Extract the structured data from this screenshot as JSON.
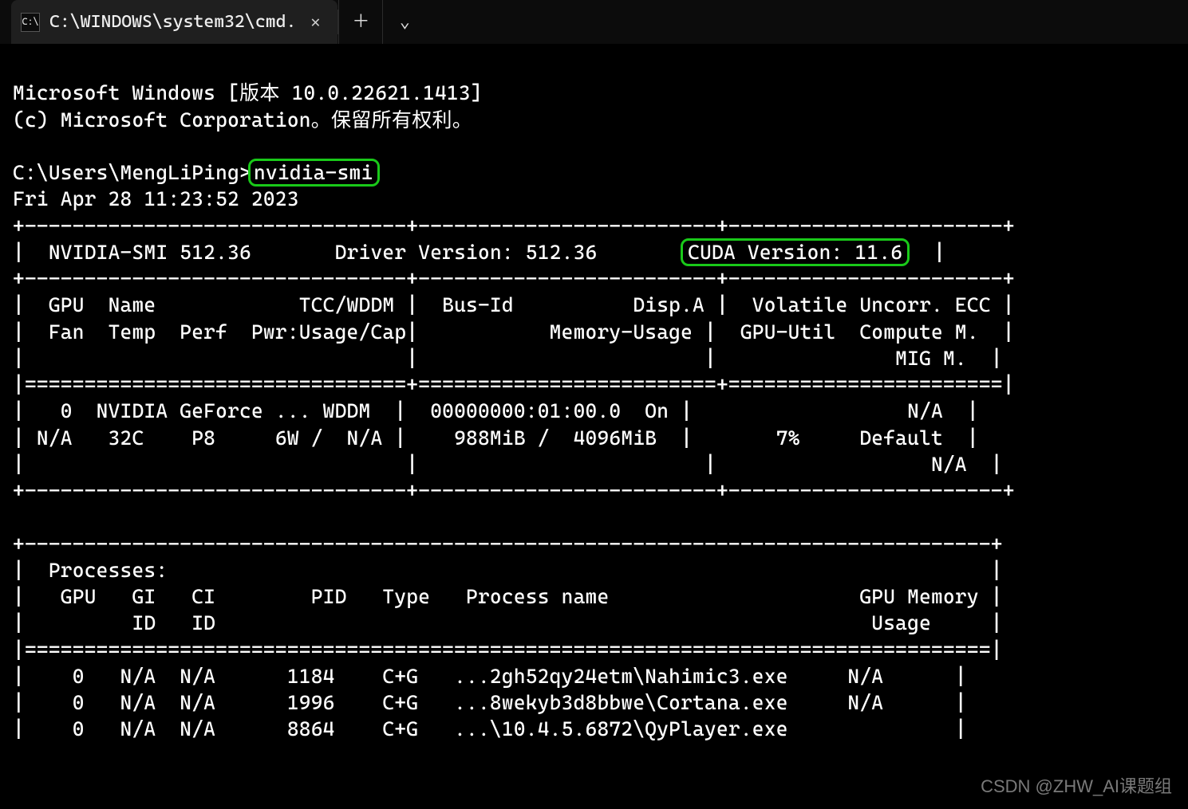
{
  "tab": {
    "icon_name": "cmd-icon",
    "title": "C:\\WINDOWS\\system32\\cmd.",
    "close_glyph": "✕",
    "newtab_glyph": "＋",
    "dropdown_glyph": "⌄"
  },
  "banner": {
    "line1": "Microsoft Windows [版本 10.0.22621.1413]",
    "line2": "(c) Microsoft Corporation。保留所有权利。"
  },
  "prompt": {
    "path_prefix": "C:\\Users\\MengLiPing>",
    "command": "nvidia-smi"
  },
  "timestamp": "Fri Apr 28 11:23:52 2023",
  "smi": {
    "header_left": "NVIDIA-SMI 512.36",
    "header_mid": "Driver Version: 512.36",
    "header_right": "CUDA Version: 11.6",
    "cols": {
      "row1": "|  GPU  Name            TCC/WDDM |  Bus-Id          Disp.A |  Volatile Uncorr. ECC |",
      "row2": "|  Fan  Temp  Perf  Pwr:Usage/Cap|           Memory-Usage |  GPU-Util  Compute M.  |",
      "row3": "|                                |                        |               MIG M.  |"
    },
    "gpu0": {
      "line1": "|   0  NVIDIA GeForce ... WDDM  |  00000000:01:00.0  On |                  N/A  |",
      "line2": "| N/A   32C    P8     6W /  N/A |    988MiB /  4096MiB  |       7%     Default  |",
      "line3": "|                                |                        |                  N/A  |"
    },
    "processes": {
      "title": "|  Processes:                                                                     |",
      "hdr1": "|   GPU   GI   CI        PID   Type   Process name                     GPU Memory |",
      "hdr2": "|         ID   ID                                                       Usage     |",
      "rows": [
        "|    0   N/A  N/A      1184    C+G   ...2gh52qy24etm\\Nahimic3.exe     N/A      |",
        "|    0   N/A  N/A      1996    C+G   ...8wekyb3d8bbwe\\Cortana.exe     N/A      |",
        "|    0   N/A  N/A      8864    C+G   ...\\10.4.5.6872\\QyPlayer.exe              |"
      ]
    },
    "sep_top": "+--------------------------------+-------------------------+-----------------------+",
    "sep_eq": "|================================+=========================+=======================|",
    "sep_bot": "+--------------------------------+-------------------------+-----------------------+",
    "proc_top": "+---------------------------------------------------------------------------------+",
    "proc_eq": "|=================================================================================|"
  },
  "watermark": "CSDN @ZHW_AI课题组"
}
